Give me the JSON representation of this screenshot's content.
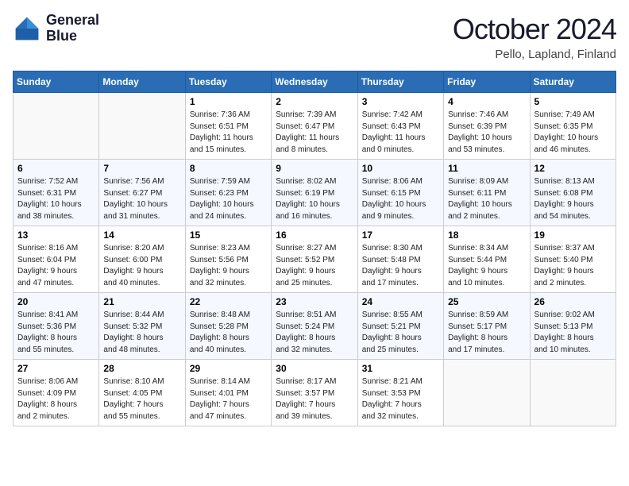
{
  "header": {
    "logo_line1": "General",
    "logo_line2": "Blue",
    "month": "October 2024",
    "location": "Pello, Lapland, Finland"
  },
  "weekdays": [
    "Sunday",
    "Monday",
    "Tuesday",
    "Wednesday",
    "Thursday",
    "Friday",
    "Saturday"
  ],
  "weeks": [
    [
      {
        "day": "",
        "info": ""
      },
      {
        "day": "",
        "info": ""
      },
      {
        "day": "1",
        "info": "Sunrise: 7:36 AM\nSunset: 6:51 PM\nDaylight: 11 hours\nand 15 minutes."
      },
      {
        "day": "2",
        "info": "Sunrise: 7:39 AM\nSunset: 6:47 PM\nDaylight: 11 hours\nand 8 minutes."
      },
      {
        "day": "3",
        "info": "Sunrise: 7:42 AM\nSunset: 6:43 PM\nDaylight: 11 hours\nand 0 minutes."
      },
      {
        "day": "4",
        "info": "Sunrise: 7:46 AM\nSunset: 6:39 PM\nDaylight: 10 hours\nand 53 minutes."
      },
      {
        "day": "5",
        "info": "Sunrise: 7:49 AM\nSunset: 6:35 PM\nDaylight: 10 hours\nand 46 minutes."
      }
    ],
    [
      {
        "day": "6",
        "info": "Sunrise: 7:52 AM\nSunset: 6:31 PM\nDaylight: 10 hours\nand 38 minutes."
      },
      {
        "day": "7",
        "info": "Sunrise: 7:56 AM\nSunset: 6:27 PM\nDaylight: 10 hours\nand 31 minutes."
      },
      {
        "day": "8",
        "info": "Sunrise: 7:59 AM\nSunset: 6:23 PM\nDaylight: 10 hours\nand 24 minutes."
      },
      {
        "day": "9",
        "info": "Sunrise: 8:02 AM\nSunset: 6:19 PM\nDaylight: 10 hours\nand 16 minutes."
      },
      {
        "day": "10",
        "info": "Sunrise: 8:06 AM\nSunset: 6:15 PM\nDaylight: 10 hours\nand 9 minutes."
      },
      {
        "day": "11",
        "info": "Sunrise: 8:09 AM\nSunset: 6:11 PM\nDaylight: 10 hours\nand 2 minutes."
      },
      {
        "day": "12",
        "info": "Sunrise: 8:13 AM\nSunset: 6:08 PM\nDaylight: 9 hours\nand 54 minutes."
      }
    ],
    [
      {
        "day": "13",
        "info": "Sunrise: 8:16 AM\nSunset: 6:04 PM\nDaylight: 9 hours\nand 47 minutes."
      },
      {
        "day": "14",
        "info": "Sunrise: 8:20 AM\nSunset: 6:00 PM\nDaylight: 9 hours\nand 40 minutes."
      },
      {
        "day": "15",
        "info": "Sunrise: 8:23 AM\nSunset: 5:56 PM\nDaylight: 9 hours\nand 32 minutes."
      },
      {
        "day": "16",
        "info": "Sunrise: 8:27 AM\nSunset: 5:52 PM\nDaylight: 9 hours\nand 25 minutes."
      },
      {
        "day": "17",
        "info": "Sunrise: 8:30 AM\nSunset: 5:48 PM\nDaylight: 9 hours\nand 17 minutes."
      },
      {
        "day": "18",
        "info": "Sunrise: 8:34 AM\nSunset: 5:44 PM\nDaylight: 9 hours\nand 10 minutes."
      },
      {
        "day": "19",
        "info": "Sunrise: 8:37 AM\nSunset: 5:40 PM\nDaylight: 9 hours\nand 2 minutes."
      }
    ],
    [
      {
        "day": "20",
        "info": "Sunrise: 8:41 AM\nSunset: 5:36 PM\nDaylight: 8 hours\nand 55 minutes."
      },
      {
        "day": "21",
        "info": "Sunrise: 8:44 AM\nSunset: 5:32 PM\nDaylight: 8 hours\nand 48 minutes."
      },
      {
        "day": "22",
        "info": "Sunrise: 8:48 AM\nSunset: 5:28 PM\nDaylight: 8 hours\nand 40 minutes."
      },
      {
        "day": "23",
        "info": "Sunrise: 8:51 AM\nSunset: 5:24 PM\nDaylight: 8 hours\nand 32 minutes."
      },
      {
        "day": "24",
        "info": "Sunrise: 8:55 AM\nSunset: 5:21 PM\nDaylight: 8 hours\nand 25 minutes."
      },
      {
        "day": "25",
        "info": "Sunrise: 8:59 AM\nSunset: 5:17 PM\nDaylight: 8 hours\nand 17 minutes."
      },
      {
        "day": "26",
        "info": "Sunrise: 9:02 AM\nSunset: 5:13 PM\nDaylight: 8 hours\nand 10 minutes."
      }
    ],
    [
      {
        "day": "27",
        "info": "Sunrise: 8:06 AM\nSunset: 4:09 PM\nDaylight: 8 hours\nand 2 minutes."
      },
      {
        "day": "28",
        "info": "Sunrise: 8:10 AM\nSunset: 4:05 PM\nDaylight: 7 hours\nand 55 minutes."
      },
      {
        "day": "29",
        "info": "Sunrise: 8:14 AM\nSunset: 4:01 PM\nDaylight: 7 hours\nand 47 minutes."
      },
      {
        "day": "30",
        "info": "Sunrise: 8:17 AM\nSunset: 3:57 PM\nDaylight: 7 hours\nand 39 minutes."
      },
      {
        "day": "31",
        "info": "Sunrise: 8:21 AM\nSunset: 3:53 PM\nDaylight: 7 hours\nand 32 minutes."
      },
      {
        "day": "",
        "info": ""
      },
      {
        "day": "",
        "info": ""
      }
    ]
  ]
}
